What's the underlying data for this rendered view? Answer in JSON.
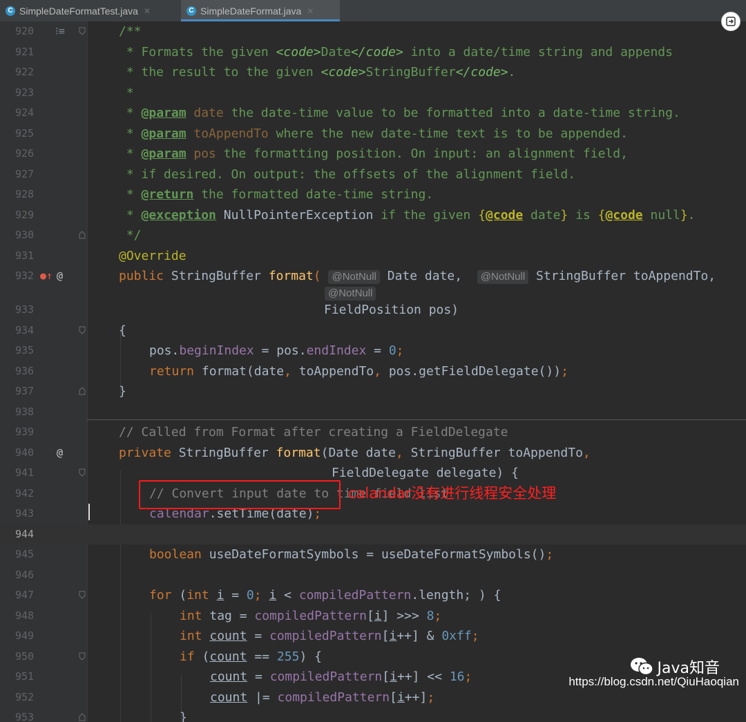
{
  "tabs": [
    {
      "label": "SimpleDateFormatTest.java",
      "active": false
    },
    {
      "label": "SimpleDateFormat.java",
      "active": true
    }
  ],
  "lines": [
    {
      "n": "920"
    },
    {
      "n": "921"
    },
    {
      "n": "922"
    },
    {
      "n": "923"
    },
    {
      "n": "924"
    },
    {
      "n": "925"
    },
    {
      "n": "926"
    },
    {
      "n": "927"
    },
    {
      "n": "928"
    },
    {
      "n": "929"
    },
    {
      "n": "930"
    },
    {
      "n": "931"
    },
    {
      "n": "932"
    },
    {
      "n": ""
    },
    {
      "n": "933"
    },
    {
      "n": "934"
    },
    {
      "n": "935"
    },
    {
      "n": "936"
    },
    {
      "n": "937"
    },
    {
      "n": "938"
    },
    {
      "n": "939"
    },
    {
      "n": "940"
    },
    {
      "n": "941"
    },
    {
      "n": "942"
    },
    {
      "n": "943"
    },
    {
      "n": "944"
    },
    {
      "n": "945"
    },
    {
      "n": "946"
    },
    {
      "n": "947"
    },
    {
      "n": "948"
    },
    {
      "n": "949"
    },
    {
      "n": "950"
    },
    {
      "n": "951"
    },
    {
      "n": "952"
    },
    {
      "n": "953"
    }
  ],
  "code": {
    "l920": "/**",
    "l921": [
      " * Formats the given ",
      "<code>",
      "Date",
      "</code>",
      " into a date/time string and appends"
    ],
    "l922": [
      " * the result to the given ",
      "<code>",
      "StringBuffer",
      "</code>",
      "."
    ],
    "l923": " *",
    "l924": [
      " * ",
      "@param",
      " date",
      " the date-time value to be formatted into a date-time string."
    ],
    "l925": [
      " * ",
      "@param",
      " toAppendTo",
      " where the new date-time text is to be appended."
    ],
    "l926": [
      " * ",
      "@param",
      " pos",
      " the formatting position. On input: an alignment field,"
    ],
    "l927": " * if desired. On output: the offsets of the alignment field.",
    "l928": [
      " * ",
      "@return",
      " the formatted date-time string."
    ],
    "l929": [
      " * ",
      "@exception",
      " NullPointerException",
      " if the given ",
      "{",
      "@code",
      " date",
      "}",
      " is ",
      "{",
      "@code",
      " null",
      "}",
      "."
    ],
    "l930": " */",
    "l931": "@Override",
    "l932": [
      "public",
      " StringBuffer ",
      "format",
      "(",
      "@NotNull",
      " Date date, ",
      "@NotNull",
      " StringBuffer toAppendTo,"
    ],
    "l932b": "@NotNull",
    "l933": "FieldPosition pos)",
    "l934": "{",
    "l935": [
      "pos.",
      "beginIndex",
      " = pos.",
      "endIndex",
      " = ",
      "0",
      ";"
    ],
    "l936": [
      "return",
      " format(date",
      ",",
      " toAppendTo",
      ",",
      " pos.getFieldDelegate())",
      ";"
    ],
    "l937": "}",
    "l939": "// Called from Format after creating a FieldDelegate",
    "l940": [
      "private",
      " StringBuffer ",
      "format",
      "(Date date",
      ",",
      " StringBuffer toAppendTo",
      ","
    ],
    "l941": "FieldDelegate delegate) {",
    "l942": "// Convert input date to time field list",
    "l943": [
      "calendar",
      ".setTime(date)",
      ";"
    ],
    "l945": [
      "boolean",
      " useDateFormatSymbols = useDateFormatSymbols()",
      ";"
    ],
    "l947": [
      "for",
      " (",
      "int",
      " ",
      "i",
      " = ",
      "0",
      "; ",
      "i",
      " < ",
      "compiledPattern",
      ".length; ) {"
    ],
    "l948": [
      "int",
      " tag = ",
      "compiledPattern",
      "[",
      "i",
      "] >>> ",
      "8",
      ";"
    ],
    "l949": [
      "int",
      " ",
      "count",
      " = ",
      "compiledPattern",
      "[",
      "i",
      "++] & ",
      "0xff",
      ";"
    ],
    "l950": [
      "if",
      " (",
      "count",
      " == ",
      "255",
      ") {"
    ],
    "l951": [
      "count",
      " = ",
      "compiledPattern",
      "[",
      "i",
      "++] << ",
      "16",
      ";"
    ],
    "l952": [
      "count",
      " |= ",
      "compiledPattern",
      "[",
      "i",
      "++]",
      ";"
    ],
    "l953": "}"
  },
  "annotation": {
    "label": "calandar没有进行线程安全处理",
    "color": "#ff2020"
  },
  "watermark": {
    "brand": "Java知音",
    "url": "https://blog.csdn.net/QiuHaoqian"
  }
}
